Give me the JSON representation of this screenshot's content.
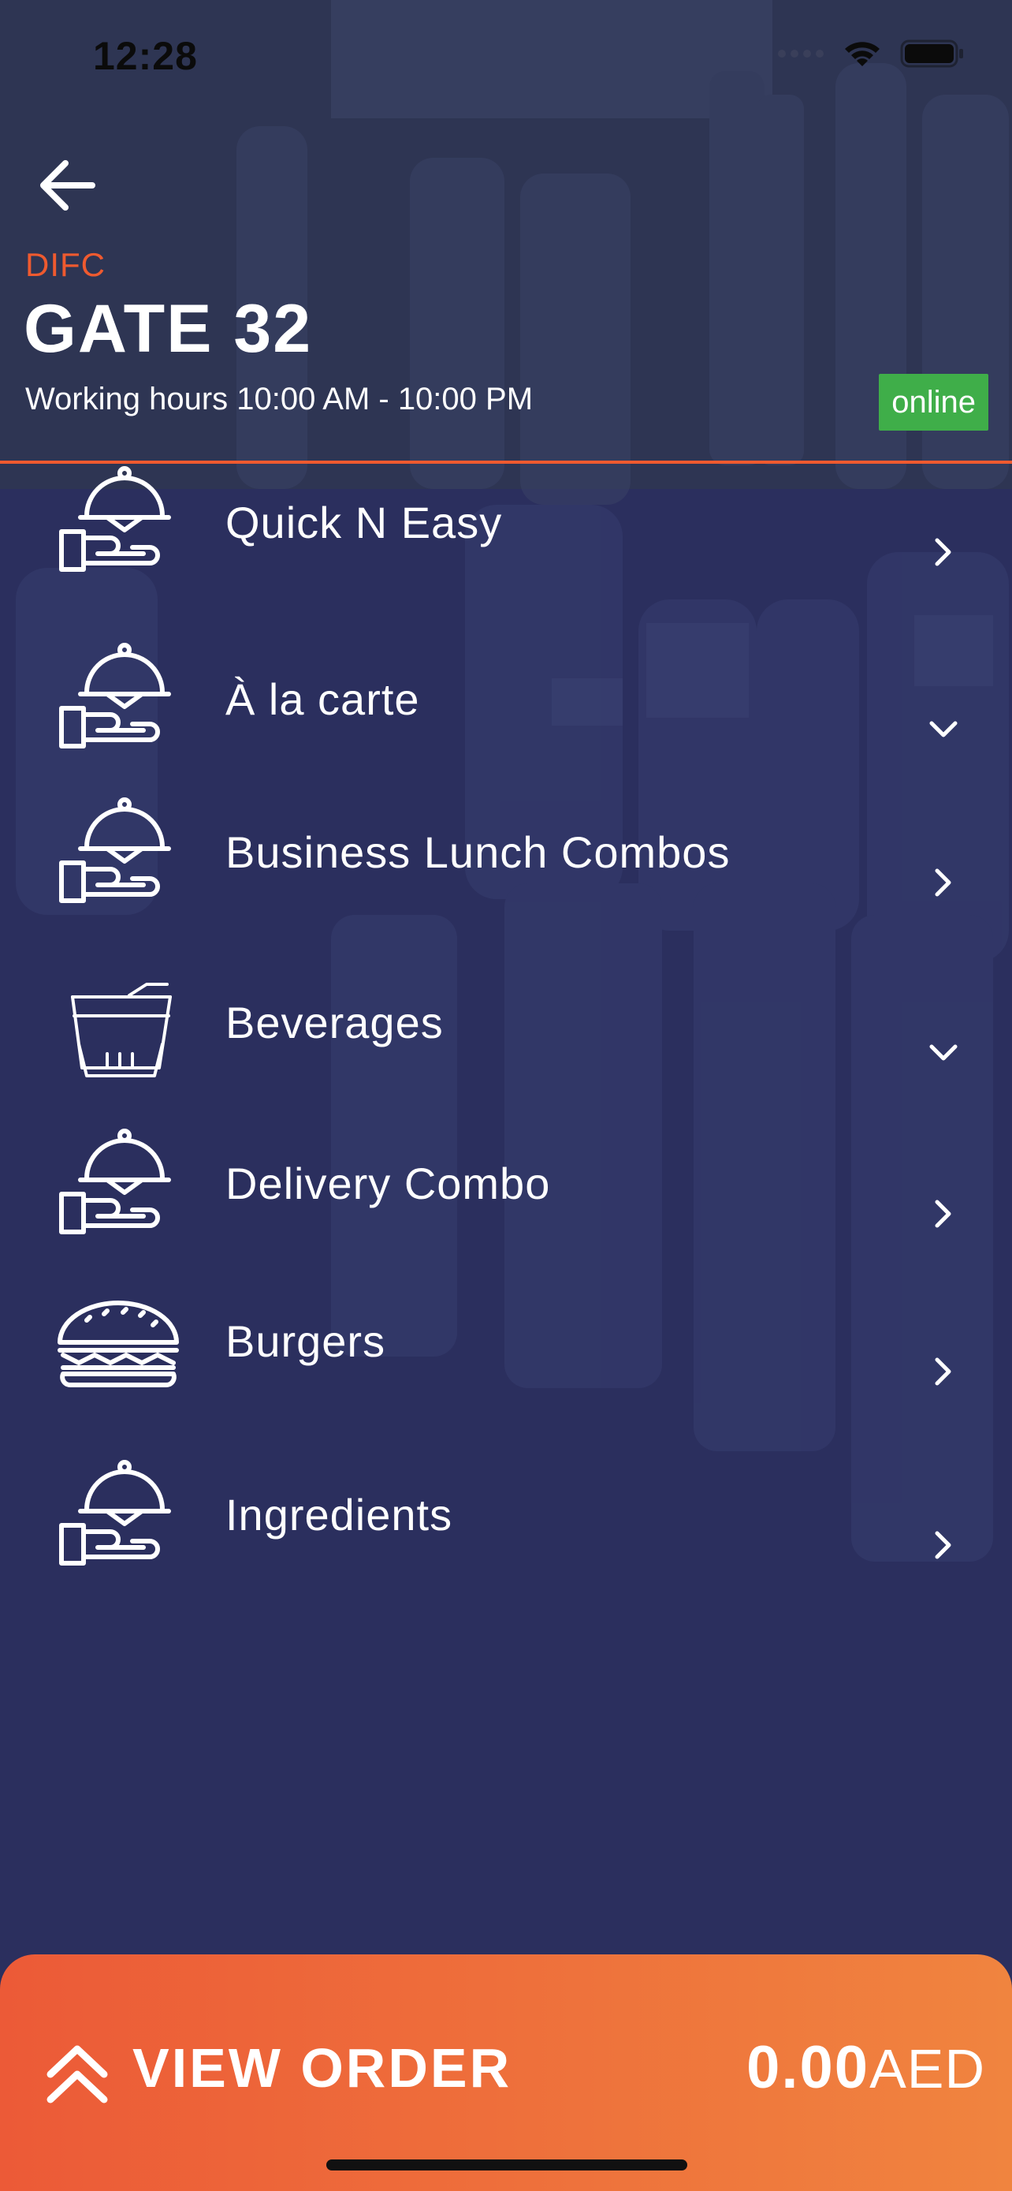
{
  "status_bar": {
    "time": "12:28"
  },
  "header": {
    "area": "DIFC",
    "restaurant_name": "GATE 32",
    "working_hours": "Working hours 10:00 AM - 10:00 PM",
    "status_badge": "online",
    "colors": {
      "accent": "#ef5a2f",
      "online": "#3fae49"
    }
  },
  "menu": {
    "categories": [
      {
        "label": "Quick N Easy",
        "icon": "serving-hand-icon",
        "chevron": "chevron-right-icon"
      },
      {
        "label": "À la carte",
        "icon": "serving-hand-icon",
        "chevron": "chevron-down-icon"
      },
      {
        "label": "Business Lunch Combos",
        "icon": "serving-hand-icon",
        "chevron": "chevron-right-icon"
      },
      {
        "label": "Beverages",
        "icon": "drink-cup-icon",
        "chevron": "chevron-down-icon"
      },
      {
        "label": "Delivery Combo",
        "icon": "serving-hand-icon",
        "chevron": "chevron-right-icon"
      },
      {
        "label": "Burgers",
        "icon": "burger-icon",
        "chevron": "chevron-right-icon"
      },
      {
        "label": "Ingredients",
        "icon": "serving-hand-icon",
        "chevron": "chevron-right-icon"
      }
    ]
  },
  "order_bar": {
    "label": "VIEW ORDER",
    "amount": "0.00",
    "currency": "AED",
    "icon": "double-chevron-up-icon"
  },
  "theme": {
    "background": "#2b2f5e",
    "order_gradient_start": "#ec5a37",
    "order_gradient_end": "#f0843f"
  }
}
